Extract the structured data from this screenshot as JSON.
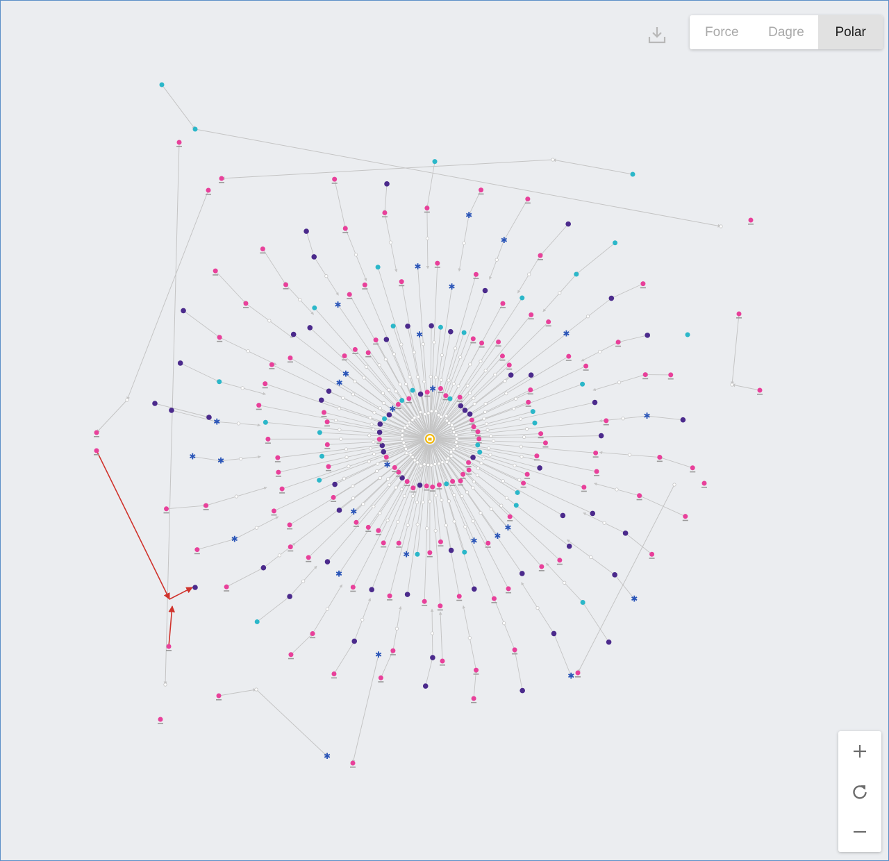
{
  "toolbar": {
    "download_icon": "download-icon",
    "layouts": [
      {
        "label": "Force",
        "active": false
      },
      {
        "label": "Dagre",
        "active": false
      },
      {
        "label": "Polar",
        "active": true
      }
    ]
  },
  "zoom_controls": {
    "zoom_in_icon": "plus-icon",
    "reset_icon": "refresh-icon",
    "zoom_out_icon": "minus-icon"
  },
  "graph": {
    "layout": "polar",
    "center_node_icon": "lock-icon",
    "highlighted_path_color": "#d0332c"
  },
  "colors": {
    "background": "#ebedf0",
    "edge": "#c4c4c4",
    "edge_highlight": "#d0332c",
    "node_pink": "#e8409a",
    "node_purple": "#4b2a8c",
    "node_teal": "#2bb7c9",
    "node_star": "#2a55b8",
    "node_center": "#f2b705",
    "active_tab_bg": "#e1e1e1"
  }
}
